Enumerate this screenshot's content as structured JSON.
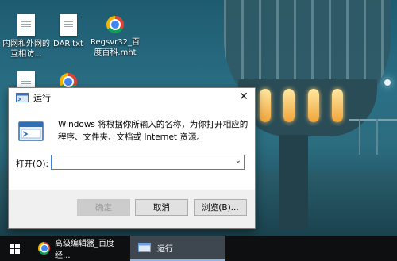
{
  "desktop": {
    "icons": [
      {
        "label": "内网和外网的互相访..."
      },
      {
        "label": "DAR.txt"
      },
      {
        "label": "Regsvr32_百度百科.mht"
      }
    ]
  },
  "run_dialog": {
    "title": "运行",
    "close_glyph": "✕",
    "description": "Windows 将根据你所输入的名称，为你打开相应的程序、文件夹、文档或 Internet 资源。",
    "open_label": "打开(O):",
    "open_value": "",
    "dropdown_glyph": "⌄",
    "ok_label": "确定",
    "cancel_label": "取消",
    "browse_label": "浏览(B)..."
  },
  "taskbar": {
    "items": [
      {
        "label": "高级编辑器_百度经..."
      },
      {
        "label": "运行"
      }
    ]
  },
  "colors": {
    "accent": "#3c82d8",
    "taskbar": "#0e0f11"
  }
}
